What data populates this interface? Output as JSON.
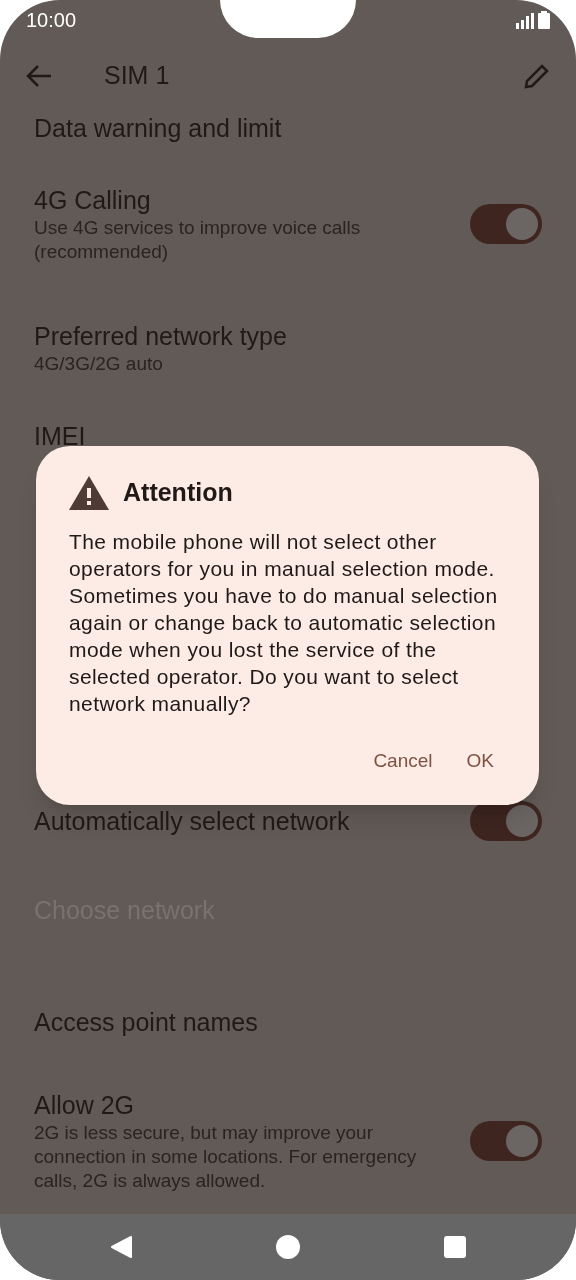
{
  "status_bar": {
    "time": "10:00"
  },
  "toolbar": {
    "title": "SIM 1"
  },
  "settings": [
    {
      "kind": "plain",
      "title": "Data warning and limit",
      "disabled": false
    },
    {
      "kind": "switch",
      "title": "4G Calling",
      "subtitle": [
        "Use 4G services to improve voice calls",
        "(recommended)"
      ],
      "on": true,
      "disabled": false
    },
    {
      "kind": "plain",
      "title": "Preferred network type",
      "subtitle": [
        "4G/3G/2G auto"
      ],
      "disabled": false
    },
    {
      "kind": "plain",
      "title": "IMEI",
      "disabled": false
    },
    {
      "kind": "switch",
      "title": "Automatically select network",
      "on": true,
      "disabled": false
    },
    {
      "kind": "plain",
      "title": "Choose network",
      "disabled": true
    },
    {
      "kind": "plain",
      "title": "Access point names",
      "disabled": false
    },
    {
      "kind": "switch",
      "title": "Allow 2G",
      "subtitle": [
        "2G is less secure, but may improve your",
        "connection in some locations. For emergency",
        "calls, 2G is always allowed."
      ],
      "on": true,
      "disabled": false
    }
  ],
  "dialog": {
    "title": "Attention",
    "message": "The mobile phone will not select other operators for you in manual selection mode. Sometimes you have to do manual selection again or change back to automatic selection mode when you lost the service of the selected operator. Do you want to select network manually?",
    "buttons": [
      "Cancel",
      "OK"
    ]
  }
}
